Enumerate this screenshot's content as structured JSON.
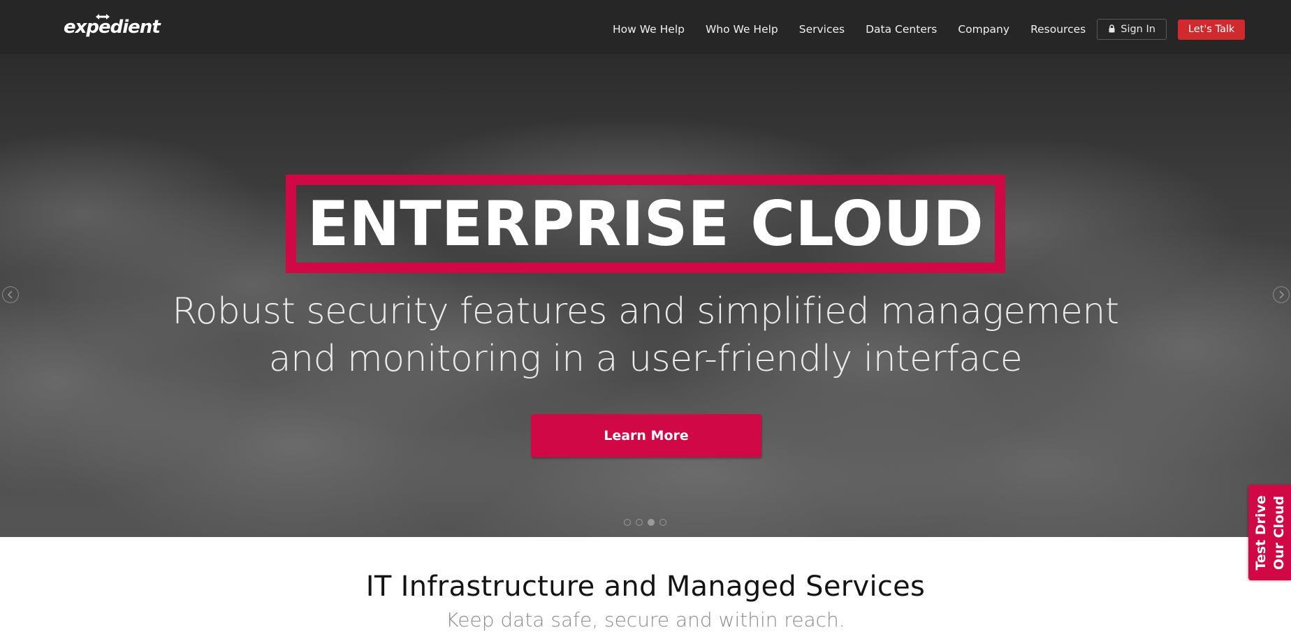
{
  "nav": {
    "logo_text": "expedient",
    "links": [
      {
        "label": "How We Help"
      },
      {
        "label": "Who We Help"
      },
      {
        "label": "Services"
      },
      {
        "label": "Data Centers"
      },
      {
        "label": "Company"
      },
      {
        "label": "Resources"
      }
    ],
    "signin_label": "Sign In",
    "letstalk_label": "Let's Talk",
    "background_color": "#262626",
    "letstalk_color": "#cf2a2e"
  },
  "hero": {
    "headline": "ENTERPRISE CLOUD",
    "subheadline_line1": "Robust security features and simplified management",
    "subheadline_line2": "and monitoring in a user-friendly interface",
    "cta_label": "Learn More",
    "accent_color": "#d10846",
    "prev_icon": "chevron-left-icon",
    "next_icon": "chevron-right-icon",
    "slides_total": 4,
    "active_slide": 3
  },
  "section": {
    "title": "IT Infrastructure and Managed Services",
    "subtitle": "Keep data safe, secure and within reach."
  },
  "side_tab": {
    "line1": "Test Drive",
    "line2": "Our Cloud"
  }
}
